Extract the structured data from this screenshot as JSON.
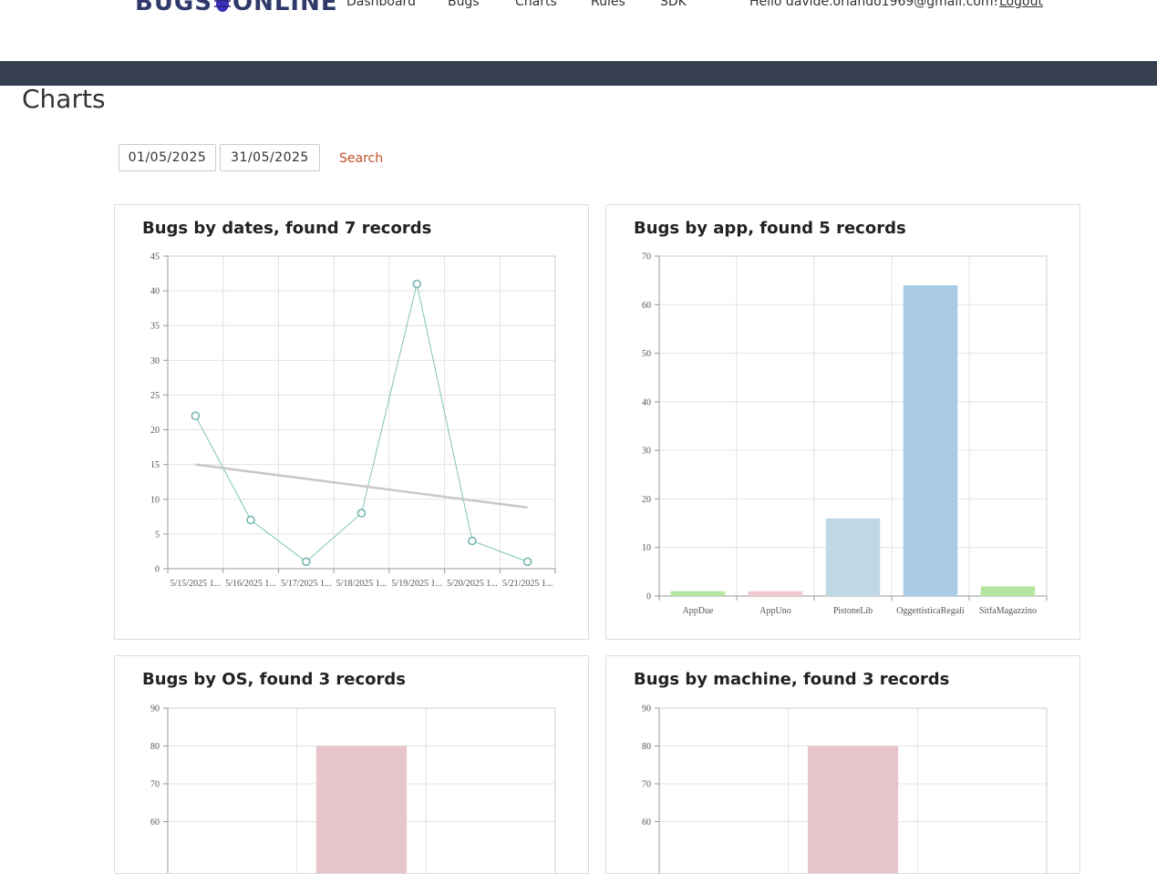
{
  "header": {
    "logo_text_left": "BUGS",
    "logo_text_right": "ONLINE",
    "nav": [
      "Dashboard",
      "Bugs",
      "Charts",
      "Rules",
      "SDK"
    ],
    "greeting": "Hello davide.orlando1969@gmail.com!",
    "logout": "Logout"
  },
  "page": {
    "title": "Charts"
  },
  "filters": {
    "date_from": "01/05/2025",
    "date_to": "31/05/2025",
    "search_label": "Search"
  },
  "colors": {
    "accent": "#c1502b",
    "band": "#363f50",
    "line": "#7fc4b4",
    "trend": "#c8c8c8"
  },
  "chart_data": [
    {
      "type": "line",
      "title": "Bugs by dates, found 7 records",
      "categories": [
        "5/15/2025 1...",
        "5/16/2025 1...",
        "5/17/2025 1...",
        "5/18/2025 1...",
        "5/19/2025 1...",
        "5/20/2025 1...",
        "5/21/2025 1..."
      ],
      "values": [
        22,
        7,
        1,
        8,
        41,
        4,
        1
      ],
      "trend": [
        15,
        8.8
      ],
      "ylim": [
        0,
        45
      ],
      "yticks": [
        0,
        5,
        10,
        15,
        20,
        25,
        30,
        35,
        40,
        45
      ],
      "grid": true
    },
    {
      "type": "bar",
      "title": "Bugs by app, found 5 records",
      "categories": [
        "AppDue",
        "AppUno",
        "PistoneLib",
        "OggettisticaRegali",
        "SitfaMagazzino"
      ],
      "values": [
        1,
        1,
        16,
        64,
        2
      ],
      "colors": [
        "#b3e6a1",
        "#f0c9d0",
        "#c0d8e4",
        "#a9cbe6",
        "#b3e6a1"
      ],
      "ylim": [
        0,
        70
      ],
      "yticks": [
        0,
        10,
        20,
        30,
        40,
        50,
        60,
        70
      ],
      "grid": true
    },
    {
      "type": "bar",
      "title": "Bugs by OS, found 3 records",
      "values": [
        80
      ],
      "colors": [
        "#e8c4cb"
      ],
      "ylim": [
        0,
        90
      ],
      "yticks": [
        60,
        70,
        80,
        90
      ],
      "grid": true
    },
    {
      "type": "bar",
      "title": "Bugs by machine, found 3 records",
      "values": [
        80
      ],
      "colors": [
        "#e8c4cb"
      ],
      "ylim": [
        0,
        90
      ],
      "yticks": [
        60,
        70,
        80,
        90
      ],
      "grid": true
    }
  ]
}
